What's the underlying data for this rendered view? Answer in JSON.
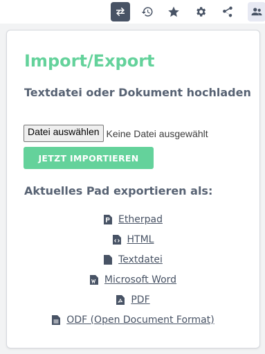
{
  "toolbar": {
    "buttons": [
      {
        "name": "import-export",
        "icon": "swap-arrows-icon",
        "active": true
      },
      {
        "name": "history",
        "icon": "history-icon"
      },
      {
        "name": "star",
        "icon": "star-icon"
      },
      {
        "name": "settings",
        "icon": "gear-icon"
      },
      {
        "name": "share",
        "icon": "share-icon"
      },
      {
        "name": "users",
        "icon": "users-icon"
      }
    ]
  },
  "panel": {
    "title": "Import/Export",
    "import_heading": "Textdatei oder Dokument hochladen",
    "file_button_label": "Datei auswählen",
    "file_status": "Keine Datei ausgewählt",
    "import_button_label": "JETZT IMPORTIEREN",
    "export_heading": "Aktuelles Pad exportieren als:",
    "export_items": [
      {
        "label": "Etherpad",
        "icon": "etherpad-file-icon"
      },
      {
        "label": "HTML",
        "icon": "code-file-icon"
      },
      {
        "label": "Textdatei",
        "icon": "text-file-icon"
      },
      {
        "label": "Microsoft Word",
        "icon": "word-file-icon"
      },
      {
        "label": "PDF",
        "icon": "pdf-file-icon"
      },
      {
        "label": "ODF (Open Document Format)",
        "icon": "document-file-icon"
      }
    ]
  },
  "colors": {
    "accent": "#64d29b",
    "text": "#576273",
    "toolbar_active": "#485365"
  }
}
